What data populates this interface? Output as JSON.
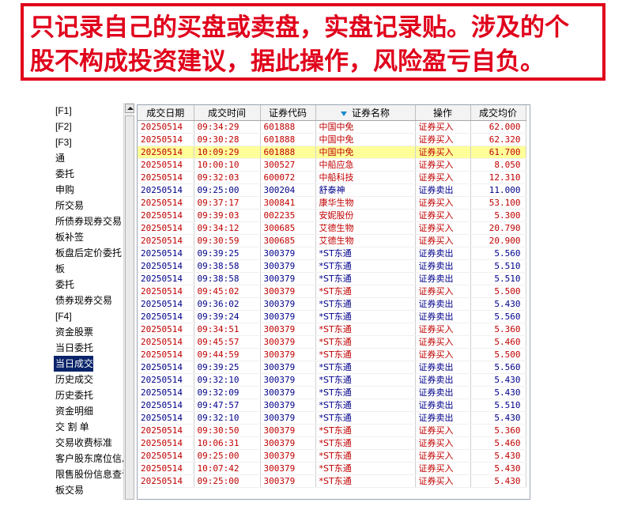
{
  "banner": {
    "line1": "只记录自己的买盘或卖盘，实盘记录贴。涉及的个",
    "line2": "股不构成投资建议，据此操作，风险盈亏自负。"
  },
  "nav": {
    "items": [
      {
        "label": "[F1]"
      },
      {
        "label": "[F2]"
      },
      {
        "label": "[F3]"
      },
      {
        "label": "通"
      },
      {
        "label": "委托"
      },
      {
        "label": "申购"
      },
      {
        "label": "所交易"
      },
      {
        "label": "所债券现券交易"
      },
      {
        "label": "板补签"
      },
      {
        "label": "板盘后定价委托"
      },
      {
        "label": "板"
      },
      {
        "label": "委托"
      },
      {
        "label": "债券现券交易"
      },
      {
        "label": "[F4]"
      },
      {
        "label": "资金股票"
      },
      {
        "label": "当日委托"
      },
      {
        "label": "当日成交",
        "selected": true
      },
      {
        "label": "历史成交"
      },
      {
        "label": "历史委托"
      },
      {
        "label": "资金明细"
      },
      {
        "label": "交 割 单"
      },
      {
        "label": "交易收费标准"
      },
      {
        "label": "客户股东席位信息"
      },
      {
        "label": "限售股份信息查询"
      },
      {
        "label": "板交易"
      }
    ]
  },
  "table": {
    "columns": [
      "成交日期",
      "成交时间",
      "证券代码",
      "证券名称",
      "操作",
      "成交均价"
    ],
    "rows": [
      {
        "date": "20250514",
        "time": "09:34:29",
        "code": "601888",
        "name": "中国中免",
        "op": "证券买入",
        "price": "62.000",
        "side": "buy"
      },
      {
        "date": "20250514",
        "time": "09:30:28",
        "code": "601888",
        "name": "中国中免",
        "op": "证券买入",
        "price": "62.320",
        "side": "buy"
      },
      {
        "date": "20250514",
        "time": "10:09:29",
        "code": "601888",
        "name": "中国中免",
        "op": "证券买入",
        "price": "61.700",
        "side": "buy",
        "highlight": true
      },
      {
        "date": "20250514",
        "time": "10:00:10",
        "code": "300527",
        "name": "中船应急",
        "op": "证券买入",
        "price": "8.050",
        "side": "buy"
      },
      {
        "date": "20250514",
        "time": "09:32:03",
        "code": "600072",
        "name": "中船科技",
        "op": "证券买入",
        "price": "12.310",
        "side": "buy"
      },
      {
        "date": "20250514",
        "time": "09:25:00",
        "code": "300204",
        "name": "舒泰神",
        "op": "证券卖出",
        "price": "11.000",
        "side": "sell"
      },
      {
        "date": "20250514",
        "time": "09:37:17",
        "code": "300841",
        "name": "康华生物",
        "op": "证券买入",
        "price": "53.100",
        "side": "buy"
      },
      {
        "date": "20250514",
        "time": "09:39:03",
        "code": "002235",
        "name": "安妮股份",
        "op": "证券买入",
        "price": "5.300",
        "side": "buy"
      },
      {
        "date": "20250514",
        "time": "09:34:12",
        "code": "300685",
        "name": "艾德生物",
        "op": "证券买入",
        "price": "20.790",
        "side": "buy"
      },
      {
        "date": "20250514",
        "time": "09:30:59",
        "code": "300685",
        "name": "艾德生物",
        "op": "证券买入",
        "price": "20.900",
        "side": "buy"
      },
      {
        "date": "20250514",
        "time": "09:39:25",
        "code": "300379",
        "name": "*ST东通",
        "op": "证券卖出",
        "price": "5.560",
        "side": "sell"
      },
      {
        "date": "20250514",
        "time": "09:38:58",
        "code": "300379",
        "name": "*ST东通",
        "op": "证券卖出",
        "price": "5.510",
        "side": "sell"
      },
      {
        "date": "20250514",
        "time": "09:38:58",
        "code": "300379",
        "name": "*ST东通",
        "op": "证券卖出",
        "price": "5.510",
        "side": "sell"
      },
      {
        "date": "20250514",
        "time": "09:45:02",
        "code": "300379",
        "name": "*ST东通",
        "op": "证券买入",
        "price": "5.500",
        "side": "buy"
      },
      {
        "date": "20250514",
        "time": "09:36:02",
        "code": "300379",
        "name": "*ST东通",
        "op": "证券卖出",
        "price": "5.430",
        "side": "sell"
      },
      {
        "date": "20250514",
        "time": "09:39:24",
        "code": "300379",
        "name": "*ST东通",
        "op": "证券卖出",
        "price": "5.560",
        "side": "sell"
      },
      {
        "date": "20250514",
        "time": "09:34:51",
        "code": "300379",
        "name": "*ST东通",
        "op": "证券买入",
        "price": "5.360",
        "side": "buy"
      },
      {
        "date": "20250514",
        "time": "09:45:57",
        "code": "300379",
        "name": "*ST东通",
        "op": "证券买入",
        "price": "5.460",
        "side": "buy"
      },
      {
        "date": "20250514",
        "time": "09:44:59",
        "code": "300379",
        "name": "*ST东通",
        "op": "证券买入",
        "price": "5.500",
        "side": "buy"
      },
      {
        "date": "20250514",
        "time": "09:39:25",
        "code": "300379",
        "name": "*ST东通",
        "op": "证券卖出",
        "price": "5.560",
        "side": "sell"
      },
      {
        "date": "20250514",
        "time": "09:32:10",
        "code": "300379",
        "name": "*ST东通",
        "op": "证券卖出",
        "price": "5.430",
        "side": "sell"
      },
      {
        "date": "20250514",
        "time": "09:32:09",
        "code": "300379",
        "name": "*ST东通",
        "op": "证券卖出",
        "price": "5.430",
        "side": "sell"
      },
      {
        "date": "20250514",
        "time": "09:47:57",
        "code": "300379",
        "name": "*ST东通",
        "op": "证券卖出",
        "price": "5.510",
        "side": "sell"
      },
      {
        "date": "20250514",
        "time": "09:32:10",
        "code": "300379",
        "name": "*ST东通",
        "op": "证券卖出",
        "price": "5.430",
        "side": "sell"
      },
      {
        "date": "20250514",
        "time": "09:30:50",
        "code": "300379",
        "name": "*ST东通",
        "op": "证券买入",
        "price": "5.360",
        "side": "buy"
      },
      {
        "date": "20250514",
        "time": "10:06:31",
        "code": "300379",
        "name": "*ST东通",
        "op": "证券买入",
        "price": "5.460",
        "side": "buy"
      },
      {
        "date": "20250514",
        "time": "09:25:00",
        "code": "300379",
        "name": "*ST东通",
        "op": "证券买入",
        "price": "5.430",
        "side": "buy"
      },
      {
        "date": "20250514",
        "time": "10:07:42",
        "code": "300379",
        "name": "*ST东通",
        "op": "证券买入",
        "price": "5.430",
        "side": "buy"
      },
      {
        "date": "20250514",
        "time": "09:25:00",
        "code": "300379",
        "name": "*ST东通",
        "op": "证券买入",
        "price": "5.430",
        "side": "buy"
      }
    ]
  },
  "colors": {
    "banner_red": "#e0001b",
    "buy_text": "#c00000",
    "sell_text": "#00008b",
    "highlight_row": "#ffff99",
    "nav_selected": "#0a246a"
  }
}
